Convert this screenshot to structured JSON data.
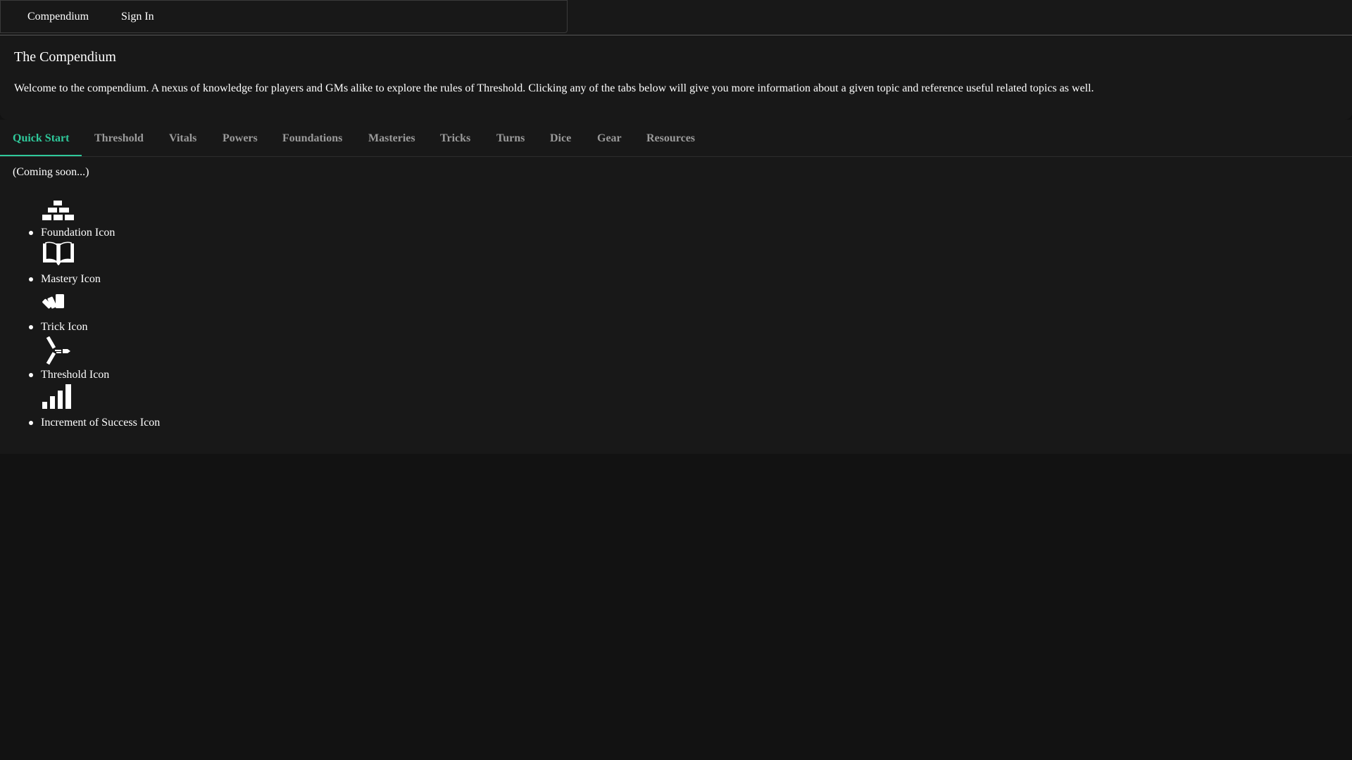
{
  "nav": {
    "compendium": "Compendium",
    "sign_in": "Sign In"
  },
  "header": {
    "title": "The Compendium",
    "intro": "Welcome to the compendium. A nexus of knowledge for players and GMs alike to explore the rules of Threshold. Clicking any of the tabs below will give you more information about a given topic and reference useful related topics as well."
  },
  "tabs": [
    {
      "label": "Quick Start",
      "active": true
    },
    {
      "label": "Threshold",
      "active": false
    },
    {
      "label": "Vitals",
      "active": false
    },
    {
      "label": "Powers",
      "active": false
    },
    {
      "label": "Foundations",
      "active": false
    },
    {
      "label": "Masteries",
      "active": false
    },
    {
      "label": "Tricks",
      "active": false
    },
    {
      "label": "Turns",
      "active": false
    },
    {
      "label": "Dice",
      "active": false
    },
    {
      "label": "Gear",
      "active": false
    },
    {
      "label": "Resources",
      "active": false
    }
  ],
  "content": {
    "coming_soon": "(Coming soon...)",
    "icons": [
      {
        "label": "Foundation Icon",
        "icon": "foundation-icon"
      },
      {
        "label": "Mastery Icon",
        "icon": "mastery-icon"
      },
      {
        "label": "Trick Icon",
        "icon": "trick-icon"
      },
      {
        "label": "Threshold Icon",
        "icon": "threshold-icon"
      },
      {
        "label": "Increment of Success Icon",
        "icon": "increment-of-success-icon"
      }
    ]
  },
  "colors": {
    "accent": "#2fc99b",
    "background": "#121212",
    "panel": "#181818",
    "tab_inactive": "#9a9a9a"
  }
}
